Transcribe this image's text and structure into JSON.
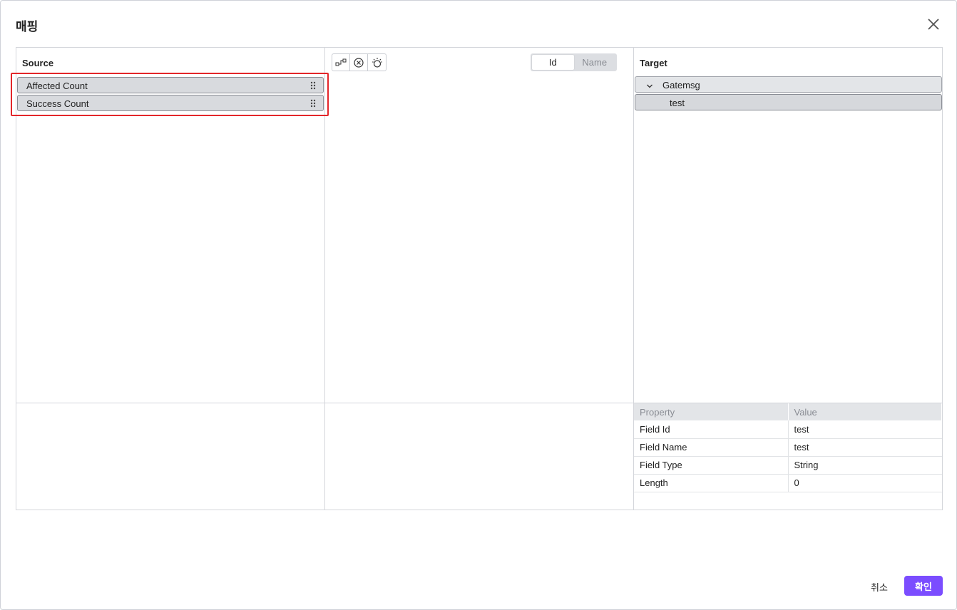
{
  "dialog": {
    "title": "매핑"
  },
  "source": {
    "label": "Source",
    "items": [
      {
        "label": "Affected Count"
      },
      {
        "label": "Success Count"
      }
    ]
  },
  "mapping": {
    "toolbar": [
      "auto-map-icon",
      "clear-icon",
      "light-bulb-icon"
    ],
    "toggle": {
      "options": [
        "Id",
        "Name"
      ],
      "selected": "Id"
    }
  },
  "target": {
    "label": "Target",
    "tree": [
      {
        "label": "Gatemsg",
        "expanded": true
      },
      {
        "label": "test"
      }
    ]
  },
  "properties": {
    "headers": [
      "Property",
      "Value"
    ],
    "rows": [
      [
        "Field Id",
        "test"
      ],
      [
        "Field Name",
        "test"
      ],
      [
        "Field Type",
        "String"
      ],
      [
        "Length",
        "0"
      ]
    ]
  },
  "footer": {
    "cancel_label": "취소",
    "ok_label": "확인"
  },
  "colors": {
    "primary": "#7b4dff",
    "highlight": "#e3262a"
  }
}
